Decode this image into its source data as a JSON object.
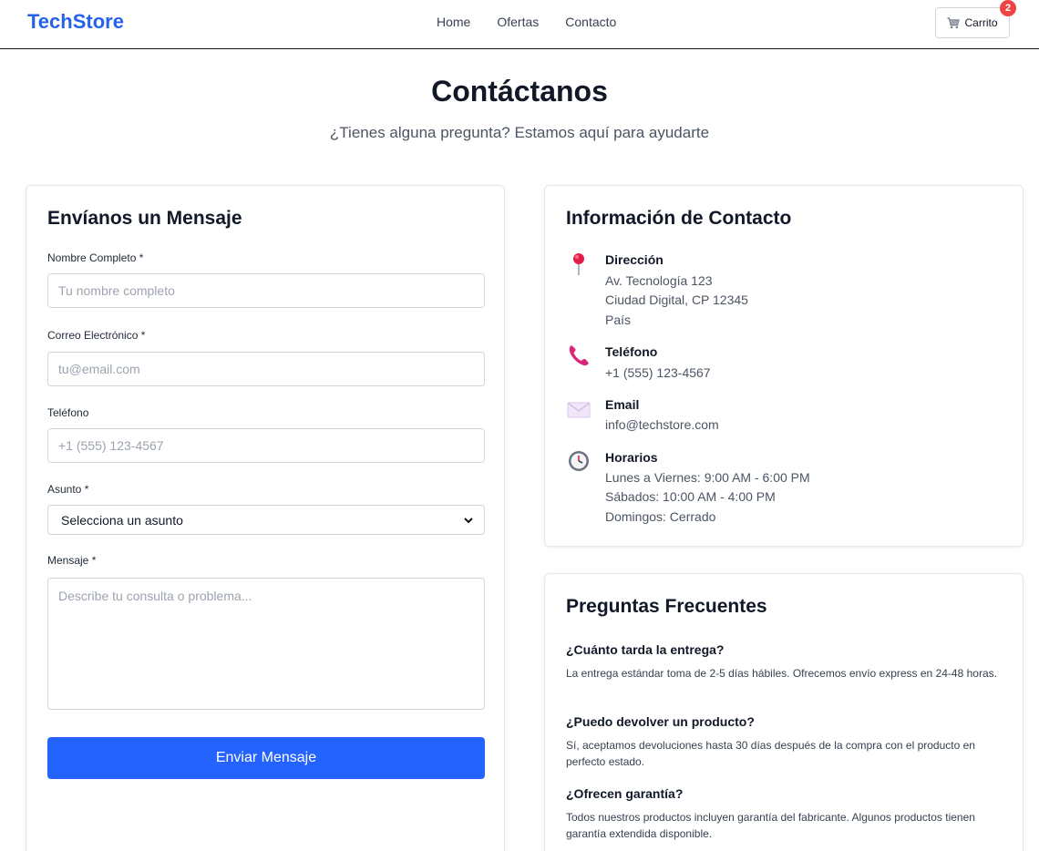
{
  "header": {
    "logo": "TechStore",
    "nav": [
      "Home",
      "Ofertas",
      "Contacto"
    ],
    "cart_label": "Carrito",
    "cart_count": "2"
  },
  "hero": {
    "title": "Contáctanos",
    "subtitle": "¿Tienes alguna pregunta? Estamos aquí para ayudarte"
  },
  "form": {
    "title": "Envíanos un Mensaje",
    "name_label": "Nombre Completo *",
    "name_placeholder": "Tu nombre completo",
    "email_label": "Correo Electrónico *",
    "email_placeholder": "tu@email.com",
    "phone_label": "Teléfono",
    "phone_placeholder": "+1 (555) 123-4567",
    "subject_label": "Asunto *",
    "subject_selected": "Selecciona un asunto",
    "message_label": "Mensaje *",
    "message_placeholder": "Describe tu consulta o problema...",
    "submit_label": "Enviar Mensaje"
  },
  "contact_info": {
    "title": "Información de Contacto",
    "address": {
      "icon": "pin-icon",
      "heading": "Dirección",
      "lines": [
        "Av. Tecnología 123",
        "Ciudad Digital, CP 12345",
        "País"
      ]
    },
    "phone": {
      "icon": "phone-icon",
      "heading": "Teléfono",
      "lines": [
        "+1 (555) 123-4567"
      ]
    },
    "email": {
      "icon": "envelope-icon",
      "heading": "Email",
      "lines": [
        "info@techstore.com"
      ]
    },
    "hours": {
      "icon": "clock-icon",
      "heading": "Horarios",
      "lines": [
        "Lunes a Viernes: 9:00 AM - 6:00 PM",
        "Sábados: 10:00 AM - 4:00 PM",
        "Domingos: Cerrado"
      ]
    }
  },
  "faq": {
    "title": "Preguntas Frecuentes",
    "items": [
      {
        "question": "¿Cuánto tarda la entrega?",
        "answer": "La entrega estándar toma de 2-5 días hábiles. Ofrecemos envío express en 24-48 horas."
      },
      {
        "question": "¿Puedo devolver un producto?",
        "answer": "Sí, aceptamos devoluciones hasta 30 días después de la compra con el producto en perfecto estado."
      },
      {
        "question": "¿Ofrecen garantía?",
        "answer": "Todos nuestros productos incluyen garantía del fabricante. Algunos productos tienen garantía extendida disponible."
      }
    ]
  },
  "colors": {
    "brand": "#2563eb",
    "button": "#2563ff",
    "badge": "#ef4444"
  }
}
